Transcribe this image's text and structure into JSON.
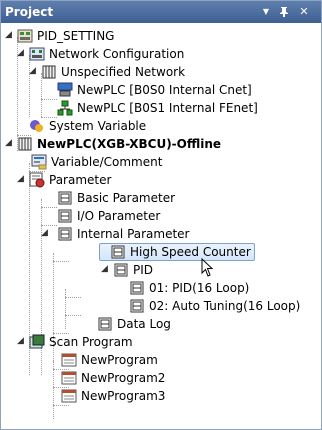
{
  "panel": {
    "title": "Project",
    "btn_dropdown": "▼",
    "btn_pin": "ᛜ",
    "btn_close": "✕"
  },
  "tree": {
    "root": "PID_SETTING",
    "network_config": "Network Configuration",
    "unspecified_network": "Unspecified Network",
    "plc_cnet": "NewPLC [B0S0 Internal Cnet]",
    "plc_fenet": "NewPLC [B0S1 Internal FEnet]",
    "system_variable": "System Variable",
    "plc_main": "NewPLC(XGB-XBCU)-Offline",
    "variable_comment": "Variable/Comment",
    "parameter": "Parameter",
    "basic_parameter": "Basic Parameter",
    "io_parameter": "I/O Parameter",
    "internal_parameter": "Internal Parameter",
    "high_speed_counter": "High Speed Counter",
    "pid": "PID",
    "pid_01": "01: PID(16 Loop)",
    "pid_02": "02: Auto Tuning(16 Loop)",
    "data_log": "Data Log",
    "scan_program": "Scan Program",
    "program1": "NewProgram",
    "program2": "NewProgram2",
    "program3": "NewProgram3"
  }
}
